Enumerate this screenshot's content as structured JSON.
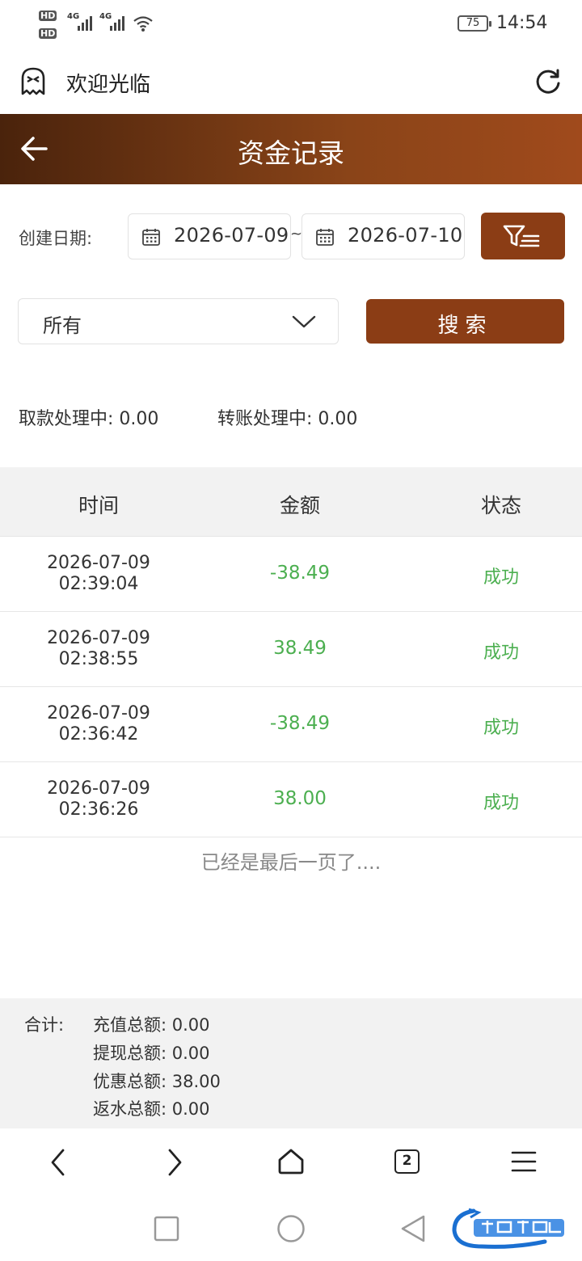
{
  "status_bar": {
    "time": "14:54",
    "battery": "75",
    "hd1": "HD",
    "hd2": "HD",
    "net1": "4G",
    "net2": "4G"
  },
  "app_bar": {
    "title": "欢迎光临"
  },
  "title_bar": {
    "title": "资金记录"
  },
  "filter": {
    "date_label": "创建日期:",
    "start_date": "2026-07-09",
    "separator": "~",
    "end_date": "2026-07-10",
    "type_select_value": "所有",
    "search_label": "搜索"
  },
  "pending": {
    "withdraw_label": "取款处理中:",
    "withdraw_value": "0.00",
    "transfer_label": "转账处理中:",
    "transfer_value": "0.00"
  },
  "table": {
    "headers": [
      "时间",
      "金额",
      "状态"
    ],
    "rows": [
      {
        "date": "2026-07-09",
        "time": "02:39:04",
        "amount": "-38.49",
        "status": "成功"
      },
      {
        "date": "2026-07-09",
        "time": "02:38:55",
        "amount": "38.49",
        "status": "成功"
      },
      {
        "date": "2026-07-09",
        "time": "02:36:42",
        "amount": "-38.49",
        "status": "成功"
      },
      {
        "date": "2026-07-09",
        "time": "02:36:26",
        "amount": "38.00",
        "status": "成功"
      }
    ],
    "end_text": "已经是最后一页了...."
  },
  "totals": {
    "label": "合计:",
    "lines": [
      {
        "label": "充值总额:",
        "value": "0.00"
      },
      {
        "label": "提现总额:",
        "value": "0.00"
      },
      {
        "label": "优惠总额:",
        "value": "38.00"
      },
      {
        "label": "返水总额:",
        "value": "0.00"
      }
    ]
  },
  "browser_nav": {
    "tab_count": "2"
  },
  "colors": {
    "brand": "#8b3d15",
    "success": "#4caf50",
    "header_bg": "#f2f2f2"
  },
  "icons": [
    "ghost-icon",
    "refresh-icon",
    "back-arrow-icon",
    "calendar-icon",
    "filter-icon",
    "chevron-down-icon",
    "browser-back-icon",
    "browser-forward-icon",
    "home-icon",
    "tabs-icon",
    "menu-icon",
    "recents-icon",
    "home-circle-icon",
    "back-triangle-icon"
  ]
}
